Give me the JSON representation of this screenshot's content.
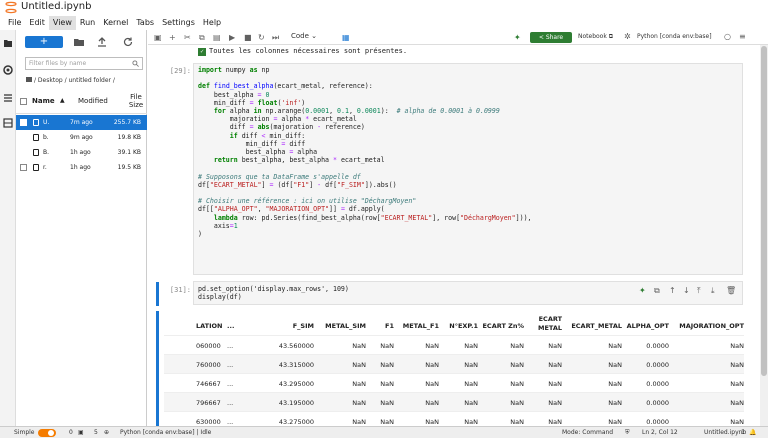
{
  "title": "Untitled.ipynb",
  "menu": [
    "File",
    "Edit",
    "View",
    "Run",
    "Kernel",
    "Tabs",
    "Settings",
    "Help"
  ],
  "filebrowser": {
    "new_label": "+",
    "filter_placeholder": "Filter files by name",
    "breadcrumb": "/ Desktop / untitled folder /",
    "headers": {
      "name": "Name",
      "modified": "Modified",
      "size": "File Size"
    },
    "files": [
      {
        "name": "U.",
        "modified": "7m ago",
        "size": "255.7 KB",
        "selected": true
      },
      {
        "name": "b.",
        "modified": "9m ago",
        "size": "19.8 KB",
        "selected": false
      },
      {
        "name": "B.",
        "modified": "1h ago",
        "size": "39.1 KB",
        "selected": false
      },
      {
        "name": "r.",
        "modified": "1h ago",
        "size": "19.5 KB",
        "selected": false
      }
    ]
  },
  "toolbar": {
    "cell_type": "Code",
    "share": "Share",
    "notebook": "Notebook",
    "kernel": "Python [conda env:base]"
  },
  "cells": {
    "output_message": "Toutes les colonnes nécessaires sont présentes.",
    "prompt1": "[29]:",
    "prompt2": "[31]:",
    "cell2_line1": "pd.set_option('display.max_rows', 109)",
    "cell2_line2": "display(df)"
  },
  "table": {
    "headers": [
      "LATION",
      "...",
      "F_SIM",
      "METAL_SIM",
      "F1",
      "METAL_F1",
      "N°EXP.1",
      "ECART Zn%",
      "ECART METAL",
      "ECART_METAL",
      "ALPHA_OPT",
      "MAJORATION_OPT"
    ],
    "rows": [
      [
        "060000",
        "...",
        "43.560000",
        "NaN",
        "NaN",
        "NaN",
        "NaN",
        "NaN",
        "NaN",
        "NaN",
        "0.0000",
        "NaN"
      ],
      [
        "760000",
        "...",
        "43.315000",
        "NaN",
        "NaN",
        "NaN",
        "NaN",
        "NaN",
        "NaN",
        "NaN",
        "0.0000",
        "NaN"
      ],
      [
        "746667",
        "...",
        "43.295000",
        "NaN",
        "NaN",
        "NaN",
        "NaN",
        "NaN",
        "NaN",
        "NaN",
        "0.0000",
        "NaN"
      ],
      [
        "796667",
        "...",
        "43.195000",
        "NaN",
        "NaN",
        "NaN",
        "NaN",
        "NaN",
        "NaN",
        "NaN",
        "0.0000",
        "NaN"
      ],
      [
        "630000",
        "...",
        "43.275000",
        "NaN",
        "NaN",
        "NaN",
        "NaN",
        "NaN",
        "NaN",
        "NaN",
        "0.0000",
        "NaN"
      ],
      [
        "680000",
        "...",
        "43.195000",
        "NaN",
        "NaN",
        "NaN",
        "NaN",
        "NaN",
        "NaN",
        "NaN",
        "0.0000",
        "NaN"
      ]
    ]
  },
  "status": {
    "mode_label": "Simple",
    "count0": "0",
    "count1": "5",
    "kernel": "Python [conda env:base] | Idle",
    "command": "Mode: Command",
    "position": "Ln 2, Col 12",
    "file": "Untitled.ipynb",
    "notif": "1"
  },
  "colors": {
    "accent": "#1976d2",
    "share": "#2e7d32",
    "toggle": "#f57c00"
  }
}
